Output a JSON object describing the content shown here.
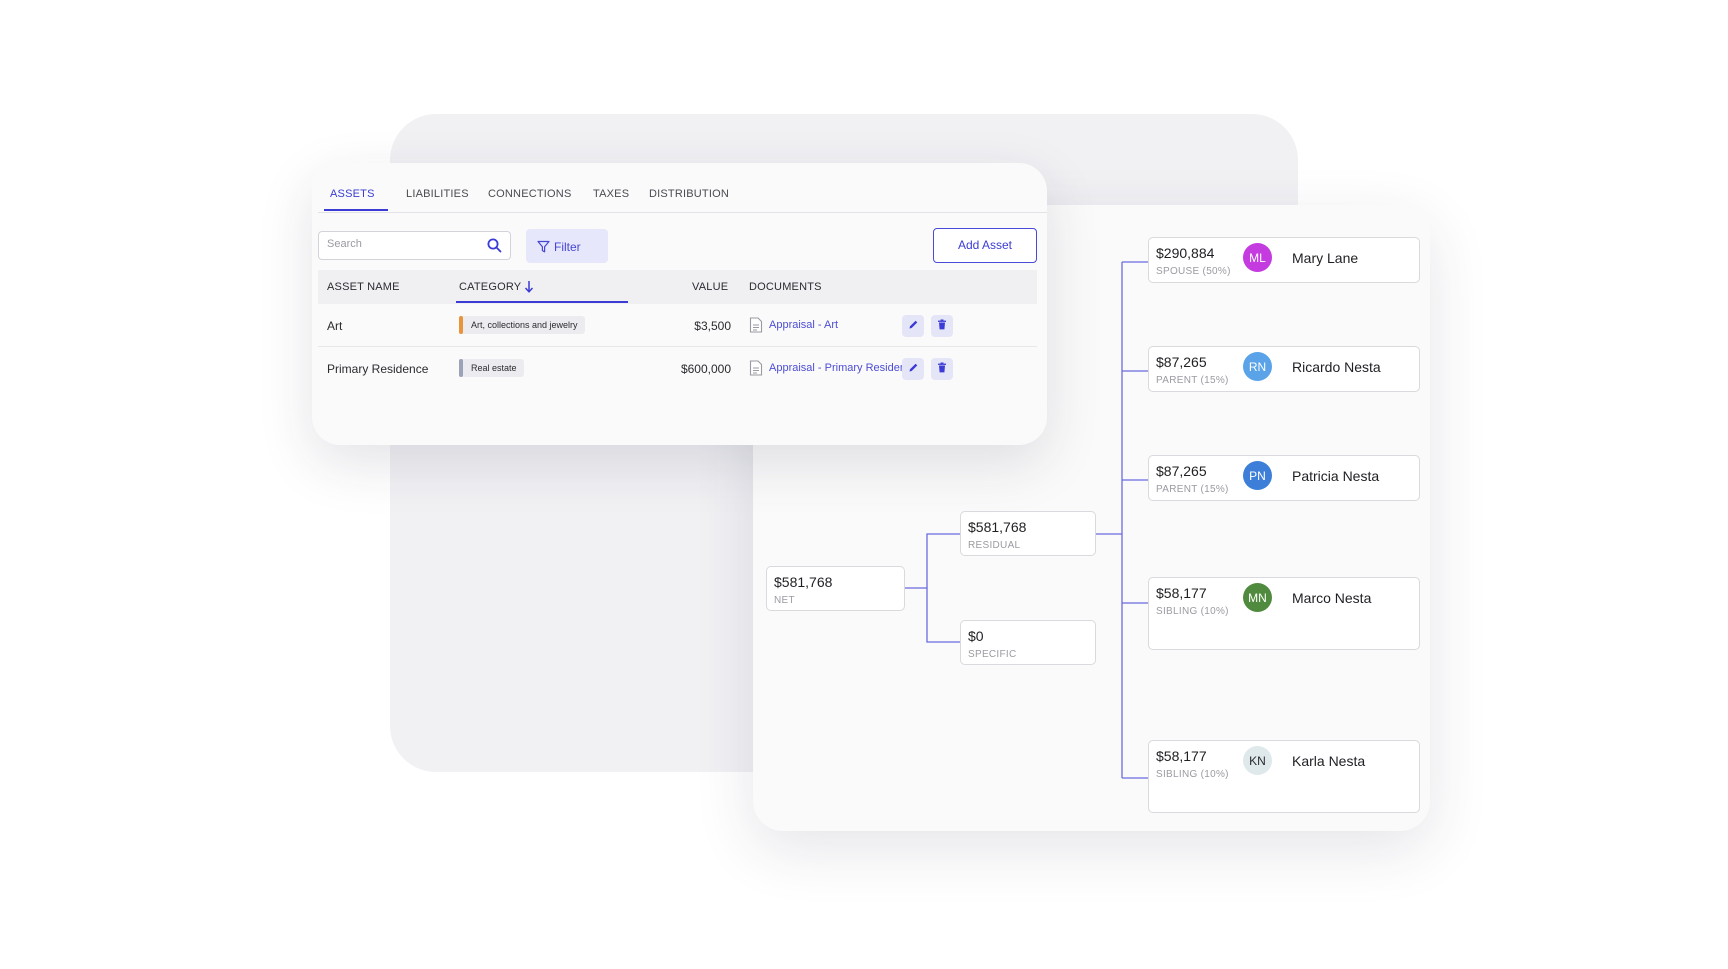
{
  "assets_panel": {
    "tabs": [
      {
        "label": "ASSETS",
        "active": true
      },
      {
        "label": "LIABILITIES",
        "active": false
      },
      {
        "label": "CONNECTIONS",
        "active": false
      },
      {
        "label": "TAXES",
        "active": false
      },
      {
        "label": "DISTRIBUTION",
        "active": false
      }
    ],
    "search_placeholder": "Search",
    "filter_label": "Filter",
    "add_asset_label": "Add Asset",
    "columns": [
      "ASSET NAME",
      "CATEGORY",
      "VALUE",
      "DOCUMENTS"
    ],
    "sort_icon": "arrow-down-icon",
    "rows": [
      {
        "name": "Art",
        "category": "Art, collections and jewelry",
        "category_color": "#e8943a",
        "value": "$3,500",
        "document": "Appraisal - Art"
      },
      {
        "name": "Primary Residence",
        "category": "Real estate",
        "category_color": "#9aa3b8",
        "value": "$600,000",
        "document": "Appraisal - Primary Residence"
      }
    ],
    "accent_color": "#3b3bd6"
  },
  "distribution_tree": {
    "net": {
      "amount": "$581,768",
      "label": "NET"
    },
    "residual": {
      "amount": "$581,768",
      "label": "RESIDUAL"
    },
    "specific": {
      "amount": "$0",
      "label": "SPECIFIC"
    },
    "heirs": [
      {
        "amount": "$290,884",
        "relation": "SPOUSE (50%)",
        "initials": "ML",
        "name": "Mary Lane",
        "avatar_color": "#c43be0"
      },
      {
        "amount": "$87,265",
        "relation": "PARENT (15%)",
        "initials": "RN",
        "name": "Ricardo Nesta",
        "avatar_color": "#5aa3e8"
      },
      {
        "amount": "$87,265",
        "relation": "PARENT (15%)",
        "initials": "PN",
        "name": "Patricia Nesta",
        "avatar_color": "#3d7fd8"
      },
      {
        "amount": "$58,177",
        "relation": "SIBLING (10%)",
        "initials": "MN",
        "name": "Marco Nesta",
        "avatar_color": "#4f8a3e"
      },
      {
        "amount": "$58,177",
        "relation": "SIBLING (10%)",
        "initials": "KN",
        "name": "Karla Nesta",
        "avatar_color": "#dfe9ec"
      }
    ],
    "connector_color": "#6b6be0"
  }
}
